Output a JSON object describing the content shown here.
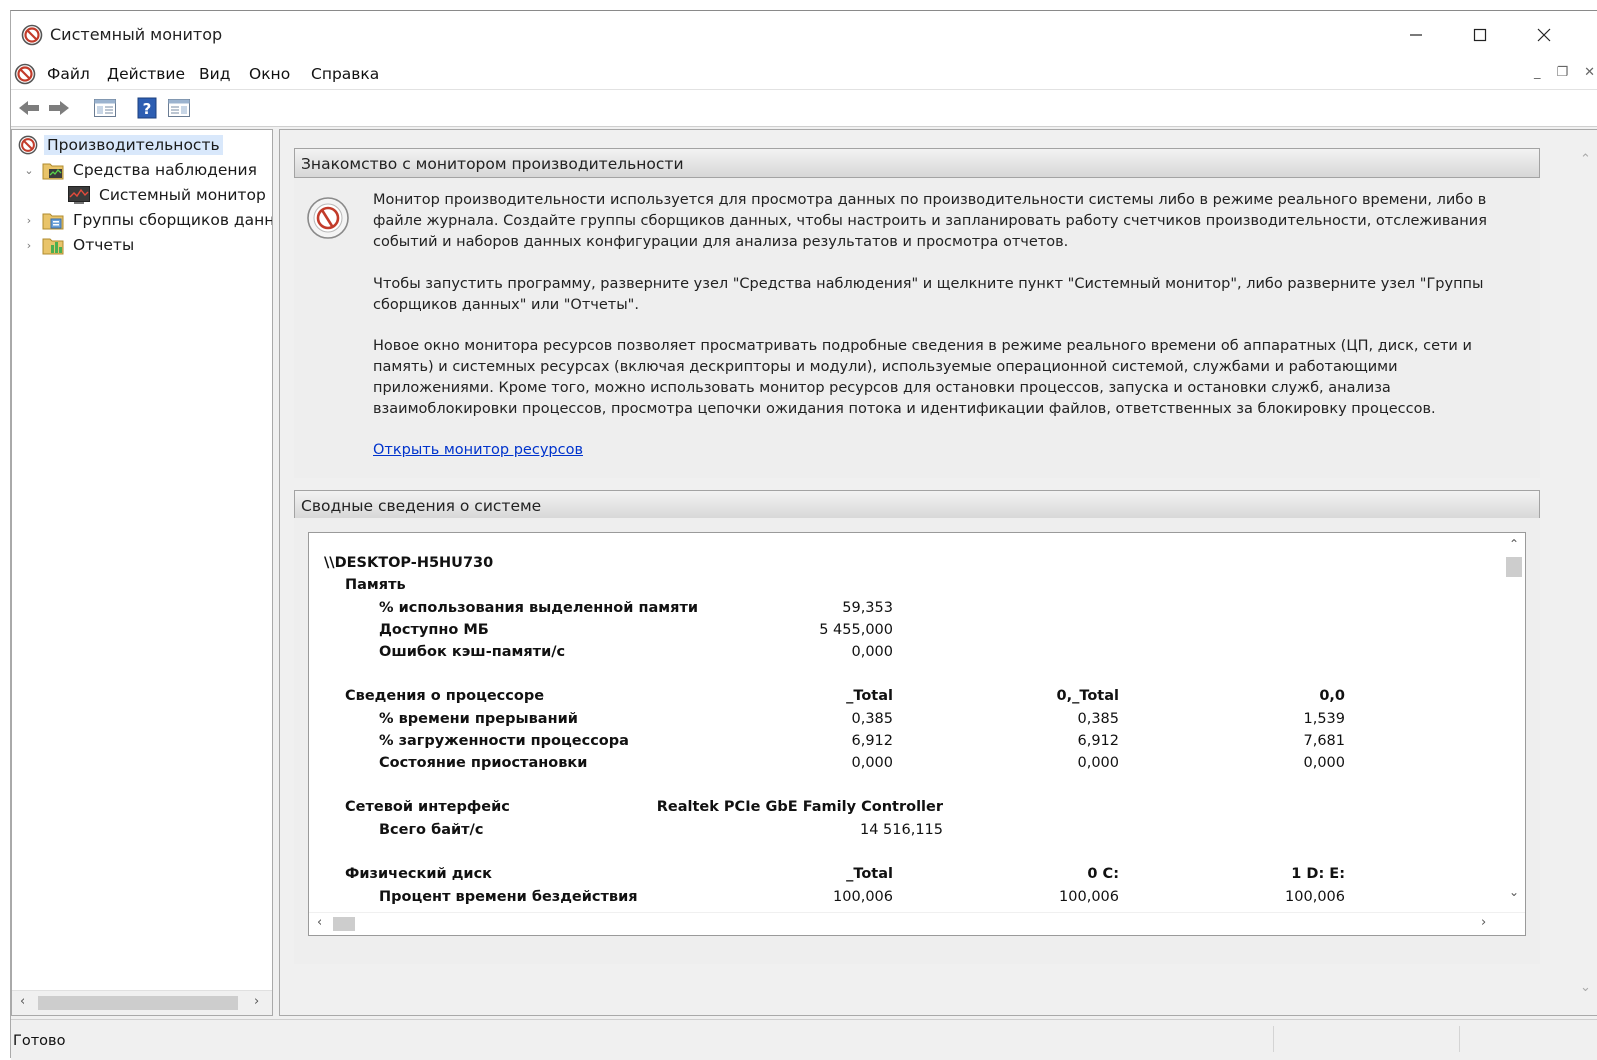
{
  "window": {
    "title": "Системный монитор"
  },
  "menu": {
    "items": [
      "Файл",
      "Действие",
      "Вид",
      "Окно",
      "Справка"
    ]
  },
  "tree": {
    "items": [
      {
        "label": "Производительность",
        "icon": "perfmon-icon",
        "selected": true
      },
      {
        "label": "Средства наблюдения",
        "icon": "monitoring-tools-icon",
        "expanded": true
      },
      {
        "label": "Системный монитор",
        "icon": "system-monitor-icon"
      },
      {
        "label": "Группы сборщиков данных",
        "icon": "data-collector-sets-icon"
      },
      {
        "label": "Отчеты",
        "icon": "reports-icon"
      }
    ]
  },
  "intro": {
    "header": "Знакомство с монитором производительности",
    "p1": "Монитор производительности используется для просмотра данных по производительности системы либо в режиме реального времени, либо в файле журнала. Создайте группы сборщиков данных, чтобы настроить и запланировать работу счетчиков производительности, отслеживания событий и наборов данных конфигурации для анализа результатов и просмотра отчетов.",
    "p2": "Чтобы запустить программу, разверните узел \"Средства наблюдения\" и щелкните пункт \"Системный монитор\", либо разверните узел \"Группы сборщиков данных\" или \"Отчеты\".",
    "p3": "Новое окно монитора ресурсов позволяет просматривать подробные сведения в режиме реального времени об аппаратных (ЦП, диск, сети и память) и системных ресурсах (включая дескрипторы и модули), используемые операционной системой, службами и работающими приложениями. Кроме того, можно использовать монитор ресурсов для остановки процессов, запуска и остановки служб, анализа взаимоблокировки процессов, просмотра цепочки ожидания потока и идентификации файлов, ответственных за блокировку процессов.",
    "link": "Открыть монитор ресурсов"
  },
  "summary": {
    "header": "Сводные сведения о системе",
    "computer": "\\\\DESKTOP-H5HU730",
    "memory": {
      "title": "Память",
      "rows": [
        {
          "label": "% использования выделенной памяти",
          "value": "59,353"
        },
        {
          "label": "Доступно МБ",
          "value": "5 455,000"
        },
        {
          "label": "Ошибок кэш-памяти/с",
          "value": "0,000"
        }
      ]
    },
    "cpu": {
      "title": "Сведения о процессоре",
      "cols": [
        "_Total",
        "0,_Total",
        "0,0"
      ],
      "rows": [
        {
          "label": "% времени прерываний",
          "values": [
            "0,385",
            "0,385",
            "1,539"
          ]
        },
        {
          "label": "% загруженности процессора",
          "values": [
            "6,912",
            "6,912",
            "7,681"
          ]
        },
        {
          "label": "Состояние приостановки",
          "values": [
            "0,000",
            "0,000",
            "0,000"
          ]
        }
      ]
    },
    "net": {
      "title": "Сетевой интерфейс",
      "adapter": "Realtek PCIe GbE Family Controller",
      "rows": [
        {
          "label": "Всего байт/с",
          "value": "14 516,115"
        }
      ]
    },
    "disk": {
      "title": "Физический диск",
      "cols": [
        "_Total",
        "0 C:",
        "1 D: E:"
      ],
      "rows": [
        {
          "label": "Процент времени бездействия",
          "values": [
            "100,006",
            "100,006",
            "100,006"
          ]
        }
      ]
    }
  },
  "status": {
    "text": "Готово"
  }
}
